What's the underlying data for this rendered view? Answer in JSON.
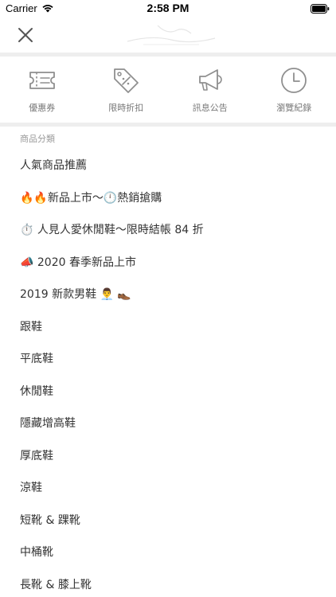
{
  "status_bar": {
    "carrier": "Carrier",
    "time": "2:58 PM"
  },
  "nav": {
    "close_icon": "close-icon"
  },
  "quick_actions": [
    {
      "label": "優惠券",
      "icon": "coupon-ticket-icon"
    },
    {
      "label": "限時折扣",
      "icon": "discount-tag-icon"
    },
    {
      "label": "訊息公告",
      "icon": "megaphone-icon"
    },
    {
      "label": "瀏覽紀錄",
      "icon": "clock-icon"
    }
  ],
  "section_header": "商品分類",
  "categories": [
    {
      "label": "人氣商品推薦"
    },
    {
      "label": "🔥🔥新品上市～🕛熱銷搶購"
    },
    {
      "label": "⏱️ 人見人愛休閒鞋～限時結帳 84 折"
    },
    {
      "label": "📣 2020 春季新品上市"
    },
    {
      "label": "2019 新款男鞋 👨‍💼 👞"
    },
    {
      "label": "跟鞋"
    },
    {
      "label": "平底鞋"
    },
    {
      "label": "休閒鞋"
    },
    {
      "label": "隱藏增高鞋"
    },
    {
      "label": "厚底鞋"
    },
    {
      "label": "涼鞋"
    },
    {
      "label": "短靴 & 踝靴"
    },
    {
      "label": "中桶靴"
    },
    {
      "label": "長靴 & 膝上靴"
    }
  ],
  "colors": {
    "icon_stroke": "#8f8f8f",
    "divider": "#eeeeee",
    "text": "#333333",
    "muted_text": "#999999"
  }
}
